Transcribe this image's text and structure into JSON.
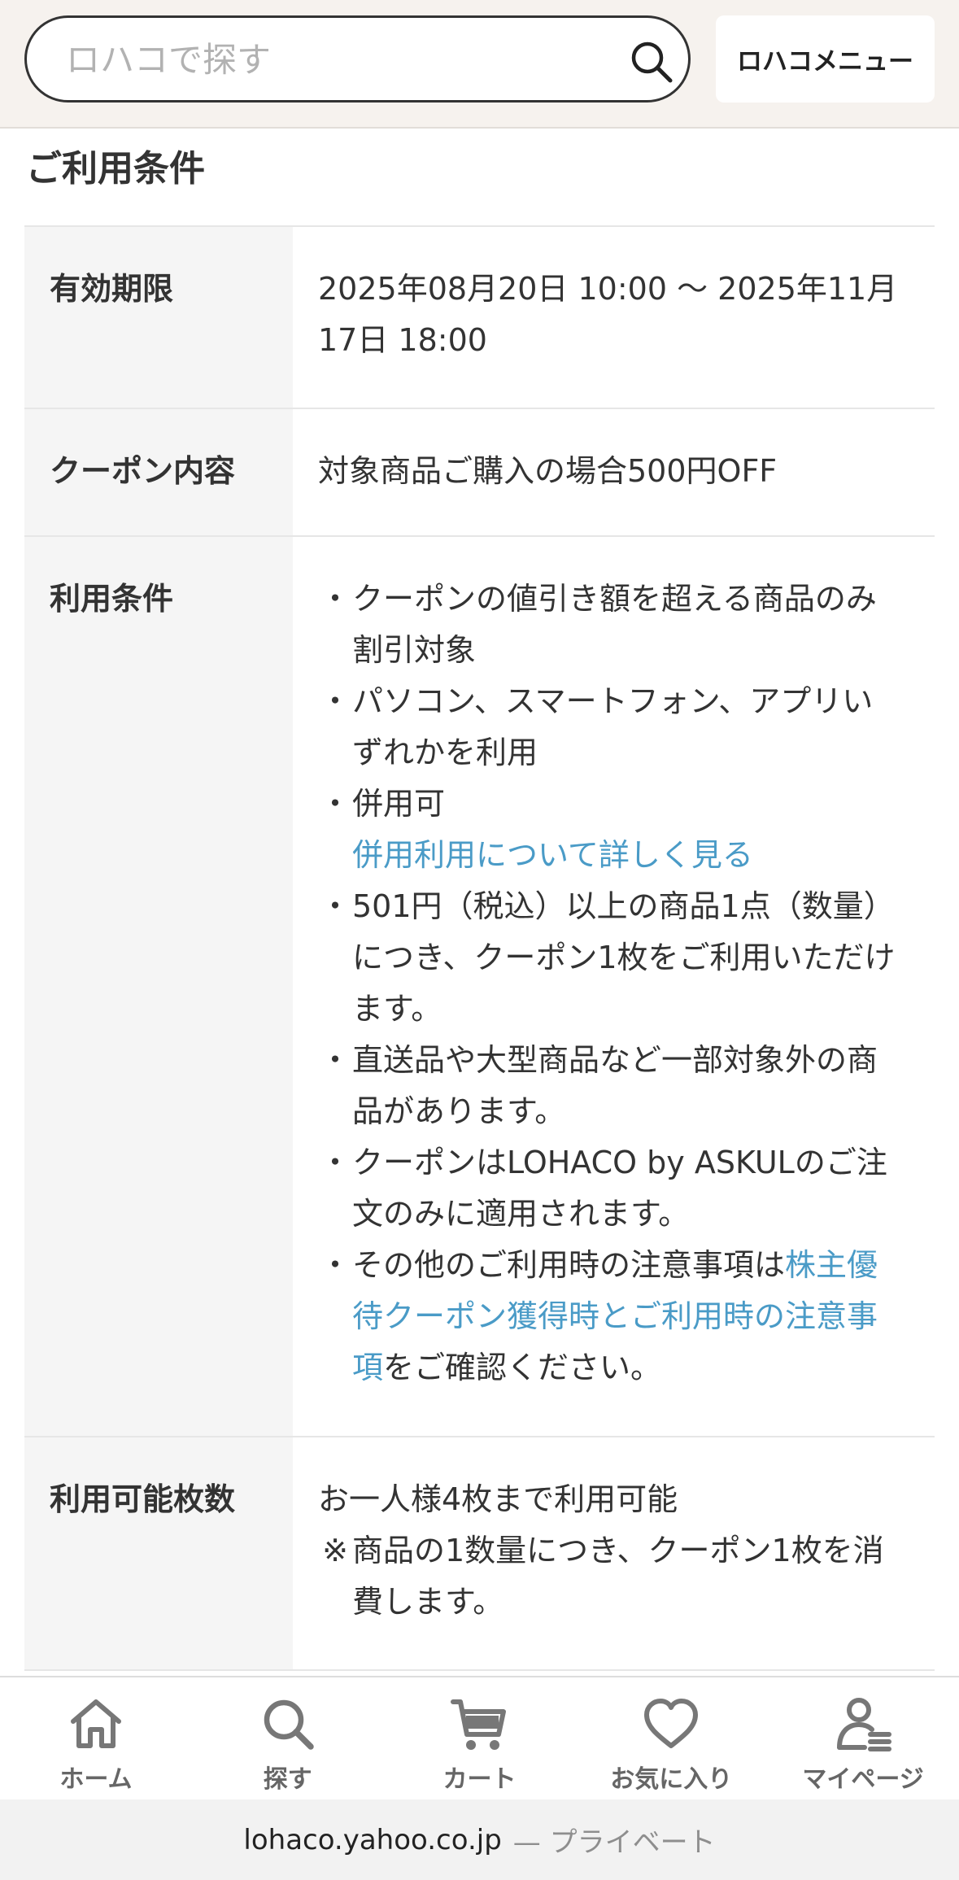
{
  "header": {
    "search_placeholder": "ロハコで探す",
    "menu_label": "ロハコメニュー"
  },
  "section_title": "ご利用条件",
  "conditions": {
    "validity": {
      "label": "有効期限",
      "value": "2025年08月20日 10:00 〜 2025年11月17日 18:00"
    },
    "coupon_content": {
      "label": "クーポン内容",
      "value": "対象商品ご購入の場合500円OFF"
    },
    "usage_terms": {
      "label": "利用条件",
      "items": [
        "クーポンの値引き額を超える商品のみ割引対象",
        "パソコン、スマートフォン、アプリいずれかを利用",
        "併用可"
      ],
      "combined_use_link": "併用利用について詳しく見る",
      "items_after": [
        "501円（税込）以上の商品1点（数量）につき、クーポン1枚をご利用いただけます。",
        "直送品や大型商品など一部対象外の商品があります。",
        "クーポンはLOHACO by ASKULのご注文のみに適用されます。"
      ],
      "last_item_prefix": "その他のご利用時の注意事項は",
      "last_item_link": "株主優待クーポン獲得時とご利用時の注意事項",
      "last_item_suffix": "をご確認ください。",
      "bullet": "・"
    },
    "usable_count": {
      "label": "利用可能枚数",
      "value": "お一人様4枚まで利用可能",
      "note_mark": "※",
      "note": "商品の1数量につき、クーポン1枚を消費します。"
    }
  },
  "bottom_nav": {
    "items": [
      {
        "label": "ホーム",
        "icon": "home-icon"
      },
      {
        "label": "探す",
        "icon": "search-icon"
      },
      {
        "label": "カート",
        "icon": "cart-icon"
      },
      {
        "label": "お気に入り",
        "icon": "heart-icon"
      },
      {
        "label": "マイページ",
        "icon": "user-icon"
      }
    ]
  },
  "browser": {
    "domain": "lohaco.yahoo.co.jp",
    "mode": "— プライベート"
  },
  "colors": {
    "link": "#4a9bc7",
    "header_bg": "#f6f2ee",
    "label_bg": "#f5f5f5",
    "nav_icon": "#777777"
  }
}
